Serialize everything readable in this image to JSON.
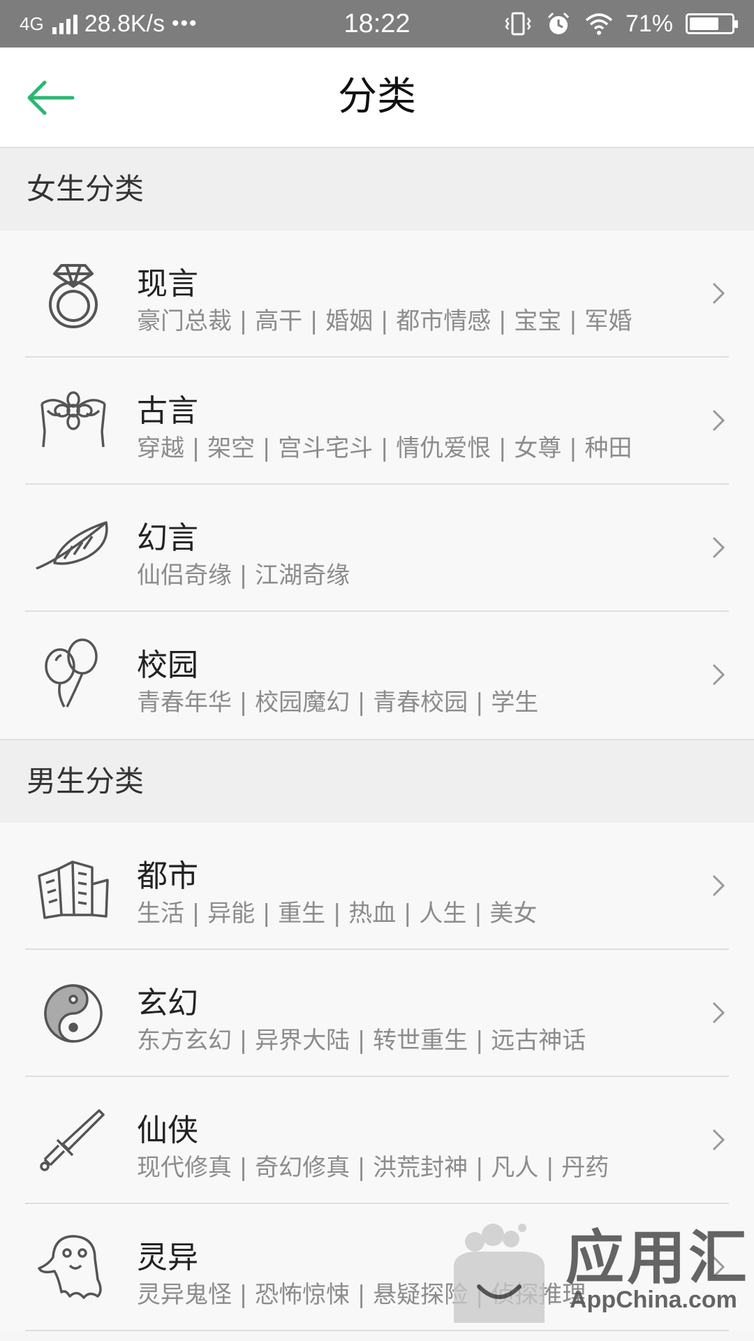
{
  "status_bar": {
    "network": "4G",
    "speed": "28.8K/s",
    "dots": "•••",
    "time": "18:22",
    "battery_percent": "71%",
    "battery_level": 0.71
  },
  "header": {
    "title": "分类",
    "back_icon": "back-arrow-icon",
    "accent_color": "#2bb673"
  },
  "sections": [
    {
      "title": "女生分类",
      "items": [
        {
          "title": "现言",
          "subtitle": "豪门总裁 | 高干 | 婚姻 | 都市情感 | 宝宝 | 军婚",
          "icon": "ring-icon"
        },
        {
          "title": "古言",
          "subtitle": "穿越 | 架空 | 宫斗宅斗 | 情仇爱恨 | 女尊 | 种田",
          "icon": "flower-ornament-icon"
        },
        {
          "title": "幻言",
          "subtitle": "仙侣奇缘 | 江湖奇缘",
          "icon": "feather-icon"
        },
        {
          "title": "校园",
          "subtitle": "青春年华 | 校园魔幻 | 青春校园 | 学生",
          "icon": "balloons-icon"
        }
      ]
    },
    {
      "title": "男生分类",
      "items": [
        {
          "title": "都市",
          "subtitle": "生活 | 异能 | 重生 | 热血 | 人生 | 美女",
          "icon": "buildings-icon"
        },
        {
          "title": "玄幻",
          "subtitle": "东方玄幻 | 异界大陆 | 转世重生 | 远古神话",
          "icon": "yin-yang-icon"
        },
        {
          "title": "仙侠",
          "subtitle": "现代修真 | 奇幻修真 | 洪荒封神 | 凡人 | 丹药",
          "icon": "sword-icon"
        },
        {
          "title": "灵异",
          "subtitle": "灵异鬼怪 | 恐怖惊悚 | 悬疑探险 | 侦探推理",
          "icon": "ghost-icon"
        }
      ]
    }
  ],
  "watermark": {
    "title": "应用汇",
    "subtitle": "AppChina.com"
  }
}
